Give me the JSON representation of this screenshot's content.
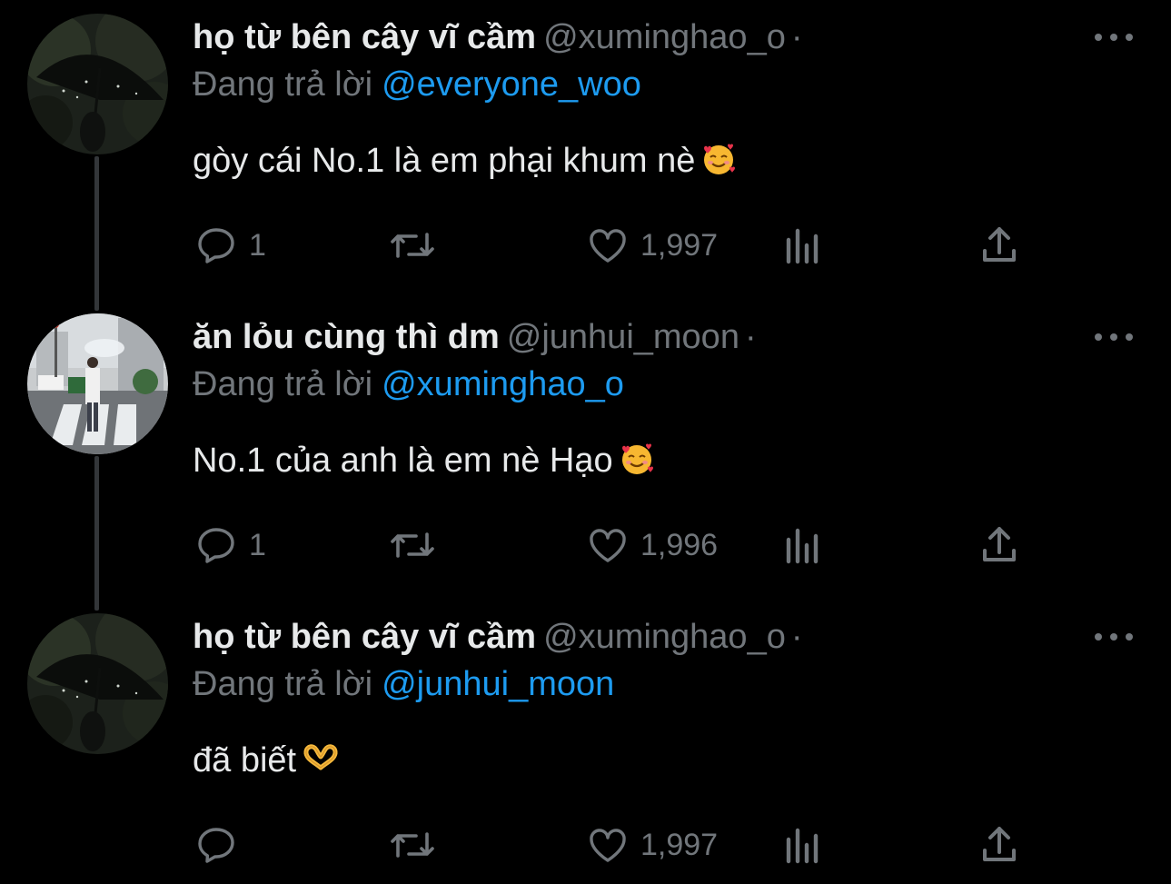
{
  "tweets": [
    {
      "display_name": "họ từ bên cây vĩ cầm",
      "handle": "@xuminghao_o",
      "separator": "·",
      "replying_label": "Đang trả lời",
      "replying_to": "@everyone_woo",
      "text": "gòy cái No.1 là em phại khum nè",
      "emoji": "smiling-face-with-hearts-icon",
      "reply_count": "1",
      "like_count": "1,997",
      "avatar": "dark-umbrella-photo"
    },
    {
      "display_name": "ăn lỏu cùng thì dm",
      "handle": "@junhui_moon",
      "separator": "·",
      "replying_label": "Đang trả lời",
      "replying_to": "@xuminghao_o",
      "text": "No.1 của anh là em nè Hạo",
      "emoji": "smiling-face-with-hearts-icon",
      "reply_count": "1",
      "like_count": "1,996",
      "avatar": "street-crosswalk-photo"
    },
    {
      "display_name": "họ từ bên cây vĩ cầm",
      "handle": "@xuminghao_o",
      "separator": "·",
      "replying_label": "Đang trả lời",
      "replying_to": "@junhui_moon",
      "text": "đã biết",
      "emoji": "heart-hands-icon",
      "reply_count": "",
      "like_count": "1,997",
      "avatar": "dark-umbrella-photo"
    }
  ],
  "colors": {
    "background": "#000000",
    "primary_text": "#e7e9ea",
    "secondary_text": "#71767b",
    "link": "#1d9bf0",
    "thread_line": "#333639"
  }
}
